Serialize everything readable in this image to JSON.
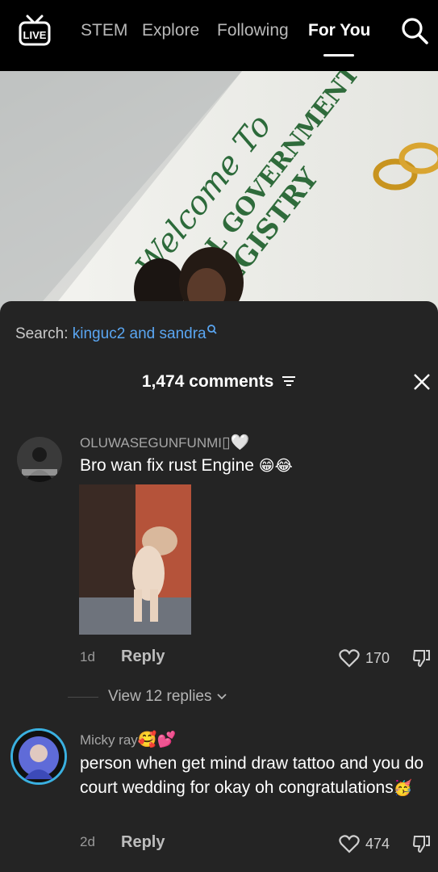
{
  "nav": {
    "live_label": "LIVE",
    "tabs": [
      {
        "label": "STEM"
      },
      {
        "label": "Explore"
      },
      {
        "label": "Following"
      },
      {
        "label": "For You"
      }
    ],
    "active_tab": "For You"
  },
  "video": {
    "sign_text_1": "Welcome To",
    "sign_text_2": "OCAL GOVERNMENT",
    "sign_text_3": "EGISTRY"
  },
  "comments_panel": {
    "search_prefix": "Search:",
    "search_term": "kinguc2 and sandra",
    "comment_count": "1,474 comments",
    "comments": [
      {
        "username": "OLUWASEGUNFUNMI",
        "username_emoji": "▯🤍",
        "text": "Bro wan fix rust Engine",
        "text_emoji": "😁😂",
        "time": "1d",
        "reply_label": "Reply",
        "likes": "170",
        "view_replies": "View 12 replies"
      },
      {
        "username": "Micky ray",
        "username_emoji": "🥰💕",
        "text": "person when get mind draw tattoo and you do court wedding for okay oh congratulations",
        "text_emoji": "🥳",
        "time": "2d",
        "reply_label": "Reply",
        "likes": "474"
      }
    ]
  },
  "colors": {
    "background": "#000000",
    "sheet": "#242424",
    "accent_link": "#5aa6f2",
    "avatar_ring": "#3ab0e0"
  }
}
